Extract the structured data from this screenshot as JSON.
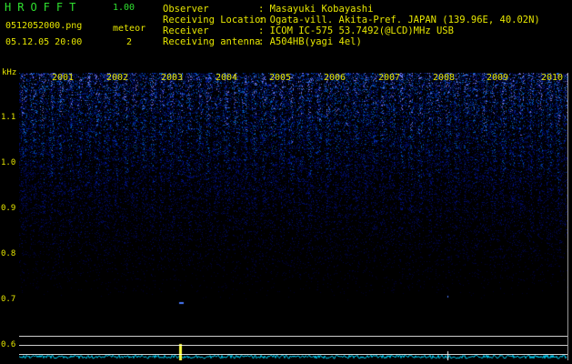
{
  "app": {
    "title": "HROFFT",
    "version": "1.00"
  },
  "file": {
    "name": "0512052000.png",
    "datetime": "05.12.05 20:00"
  },
  "meteor": {
    "label": "meteor",
    "count": "2"
  },
  "info": [
    {
      "label": "Observer",
      "value": ": Masayuki Kobayashi"
    },
    {
      "label": "Receiving Location",
      "value": ": Ogata-vill. Akita-Pref. JAPAN (139.96E, 40.02N)"
    },
    {
      "label": "Receiver",
      "value": ": ICOM IC-575 53.7492(@LCD)MHz USB"
    },
    {
      "label": "Receiving antenna",
      "value": ": A504HB(yagi 4el)"
    }
  ],
  "axis": {
    "unit": "kHz",
    "yticks": [
      "1.1",
      "1.0",
      "0.9",
      "0.8",
      "0.7",
      "0.6"
    ],
    "xticks": [
      "2001",
      "2002",
      "2003",
      "2004",
      "2005",
      "2006",
      "2007",
      "2008",
      "2009",
      "2010"
    ]
  },
  "colors": {
    "label": "#e6e600",
    "title": "#2fe02f",
    "noise": "#2a50ff",
    "meteor": "#ffff40",
    "trace": "#00d8ff"
  }
}
